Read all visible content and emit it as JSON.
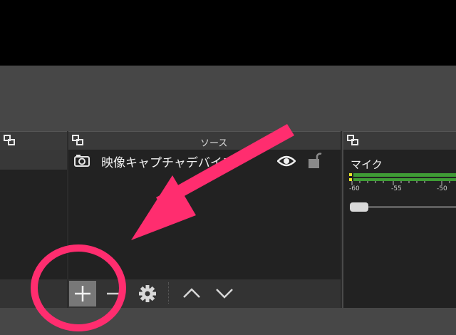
{
  "docks": {
    "sources": {
      "title": "ソース"
    }
  },
  "sources": {
    "items": [
      {
        "name": "映像キャプチャデバイス",
        "icon": "camera-icon",
        "visible": true,
        "locked": false
      }
    ]
  },
  "source_toolbar": {
    "buttons": [
      {
        "name": "add",
        "icon": "plus-icon"
      },
      {
        "name": "remove",
        "icon": "minus-icon"
      },
      {
        "name": "properties",
        "icon": "gear-icon"
      },
      {
        "name": "move-up",
        "icon": "chevron-up-icon"
      },
      {
        "name": "move-down",
        "icon": "chevron-down-icon"
      }
    ]
  },
  "mixer": {
    "channel_label": "マイク",
    "scale_ticks": [
      "-60",
      "-55",
      "-50"
    ],
    "volume_level": 0.0
  },
  "annotation": {
    "arrow_color": "#ff2d6f",
    "circle_color": "#ff2d6f"
  }
}
